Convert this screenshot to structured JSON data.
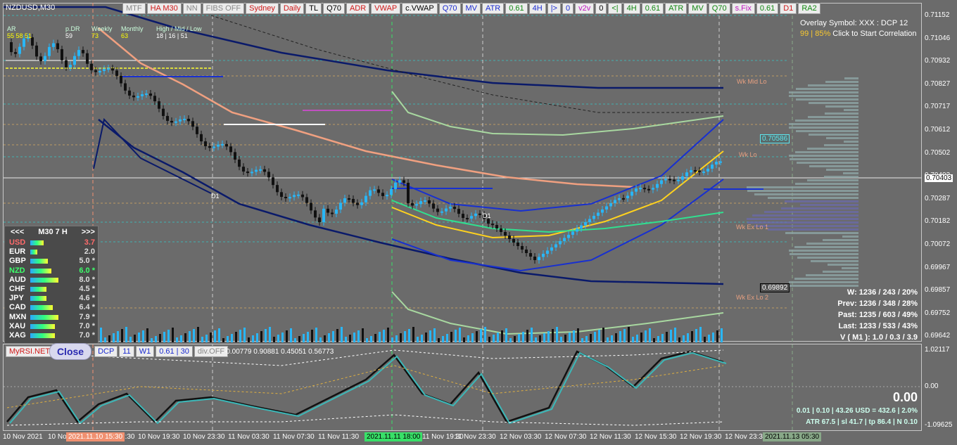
{
  "window": {
    "title": "NZDUSD,M30"
  },
  "toolbar": {
    "buttons": [
      {
        "label": "MTF",
        "style": "grey"
      },
      {
        "label": "HA M30",
        "style": "red"
      },
      {
        "label": "NN",
        "style": "grey"
      },
      {
        "label": "FIBS OFF",
        "style": "grey"
      },
      {
        "label": "Sydney",
        "style": "red"
      },
      {
        "label": "Daily",
        "style": "red"
      },
      {
        "label": "TL",
        "style": "dark"
      },
      {
        "label": "Q70",
        "style": "dark"
      },
      {
        "label": "ADR",
        "style": "red"
      },
      {
        "label": "VWAP",
        "style": "red"
      },
      {
        "label": "c.VWAP",
        "style": "dark"
      },
      {
        "label": "Q70",
        "style": "blue"
      },
      {
        "label": "MV",
        "style": "blue"
      },
      {
        "label": "ATR",
        "style": "blue"
      },
      {
        "label": "0.61",
        "style": "green"
      },
      {
        "label": "4H",
        "style": "blue"
      },
      {
        "label": "|>",
        "style": "blue"
      },
      {
        "label": "0",
        "style": "blue"
      },
      {
        "label": "v2v",
        "style": "mag"
      },
      {
        "label": "0",
        "style": "dark"
      },
      {
        "label": "<|",
        "style": "green"
      },
      {
        "label": "4H",
        "style": "green"
      },
      {
        "label": "0.61",
        "style": "green"
      },
      {
        "label": "ATR",
        "style": "green"
      },
      {
        "label": "MV",
        "style": "green"
      },
      {
        "label": "Q70",
        "style": "green"
      },
      {
        "label": "s.Fix",
        "style": "mag"
      },
      {
        "label": "0.61",
        "style": "green"
      },
      {
        "label": "D1",
        "style": "red"
      },
      {
        "label": "RA2",
        "style": "green"
      }
    ]
  },
  "header_stats": {
    "ar_label": "AR",
    "drr_label": "p.DR",
    "weekly_label": "Weekly",
    "monthly_label": "Monthly",
    "hml_label": "High / Mid / Low",
    "ar_values": "55  58  51",
    "pdr_value": "59",
    "weekly_value": "73",
    "monthly_value": "63",
    "hml_values": "18  |  16  |  51"
  },
  "overlay": {
    "line1": "Overlay Symbol: XXX : DCP 12",
    "line2_prefix": "99 | 85%",
    "line2_suffix": "Click to Start Correlation"
  },
  "chart_labels": {
    "wk_mid_lo": "Wk Mid Lo",
    "wk_lo": "Wk Lo",
    "wk_ex_lo_1": "Wk Ex Lo 1",
    "wk_ex_lo_2": "Wk Ex Lo 2",
    "d1_a": "D1",
    "d1_b": "D1"
  },
  "price_tags": {
    "tag_cyan": "0.70586",
    "tag_dark": "0.69892",
    "current": "0.70403"
  },
  "price_axis": [
    "0.71152",
    "0.71046",
    "0.70932",
    "0.70827",
    "0.70717",
    "0.70612",
    "0.70502",
    "0.70403",
    "0.70287",
    "0.70182",
    "0.70072",
    "0.69967",
    "0.69857",
    "0.69752",
    "0.69642"
  ],
  "rsi_axis": [
    "1.02117",
    "0.00",
    "-1.09625"
  ],
  "time_axis": {
    "labels": [
      "10 Nov 2021",
      "10 No",
      "10 Nov 17:30",
      "10 Nov 19:30",
      "10 Nov 23:30",
      "11 Nov 03:30",
      "11 Nov 07:30",
      "11 Nov 11:30",
      "11 Nov 19:30",
      "11 Nov 23:30",
      "12 Nov 03:30",
      "12 Nov 07:30",
      "12 Nov 11:30",
      "12 Nov 15:30",
      "12 Nov 19:30",
      "12 Nov 23:30"
    ],
    "highlight_1": "2021.11.10 15:30",
    "highlight_2": "2021.11.11 18:00",
    "highlight_3": "2021.11.13 05:30"
  },
  "strength": {
    "header_left": "<<<",
    "header_mid": "M30  7  H",
    "header_right": ">>>",
    "rows": [
      {
        "name": "USD",
        "value": "3.7",
        "level": 0.37,
        "name_color": "#ff6b6b",
        "val_color": "#ff6b6b"
      },
      {
        "name": "EUR",
        "value": "2.0",
        "level": 0.2,
        "name_color": "#ffffff",
        "val_color": "#dddddd"
      },
      {
        "name": "GBP",
        "value": "5.0 *",
        "level": 0.5,
        "name_color": "#ffffff",
        "val_color": "#dddddd"
      },
      {
        "name": "NZD",
        "value": "6.0 *",
        "level": 0.6,
        "name_color": "#3cff6a",
        "val_color": "#3cff6a"
      },
      {
        "name": "AUD",
        "value": "8.0 *",
        "level": 0.8,
        "name_color": "#ffffff",
        "val_color": "#dddddd"
      },
      {
        "name": "CHF",
        "value": "4.5 *",
        "level": 0.45,
        "name_color": "#ffffff",
        "val_color": "#dddddd"
      },
      {
        "name": "JPY",
        "value": "4.6 *",
        "level": 0.46,
        "name_color": "#ffffff",
        "val_color": "#dddddd"
      },
      {
        "name": "CAD",
        "value": "6.4 *",
        "level": 0.64,
        "name_color": "#ffffff",
        "val_color": "#dddddd"
      },
      {
        "name": "MXN",
        "value": "7.9 *",
        "level": 0.79,
        "name_color": "#ffffff",
        "val_color": "#dddddd"
      },
      {
        "name": "XAU",
        "value": "7.0 *",
        "level": 0.7,
        "name_color": "#ffffff",
        "val_color": "#dddddd"
      },
      {
        "name": "XAG",
        "value": "7.0 *",
        "level": 0.7,
        "name_color": "#ffffff",
        "val_color": "#dddddd"
      }
    ]
  },
  "stats": {
    "w": "W: 1236 / 243 / 20%",
    "prev": "Prev: 1236 / 348 / 28%",
    "past": "Past: 1235 / 603 / 49%",
    "last": "Last: 1233 / 533 / 43%",
    "v": "V ( M1 ): 1.0 / 0.3 / 3.9"
  },
  "subwindow": {
    "buttons": [
      {
        "label": "MyRSI.NET",
        "style": "red"
      },
      {
        "label": "DCP",
        "style": "blue"
      },
      {
        "label": "11",
        "style": "blue"
      },
      {
        "label": "W1",
        "style": "blue"
      },
      {
        "label": "0.61 | 30",
        "style": "blue"
      },
      {
        "label": "div.OFF",
        "style": "grey"
      }
    ],
    "close_label": "Close",
    "values": "-0.00779 0.90881 0.45051 0.56773",
    "big_value": "0.00",
    "info_line1": "0.01  |  0.10  |  43.26 USD = 432.6  |  2.0%",
    "info_line2": "ATR 67.5  |  sl 41.7  |  tp 86.4  |  N 0.10"
  }
}
